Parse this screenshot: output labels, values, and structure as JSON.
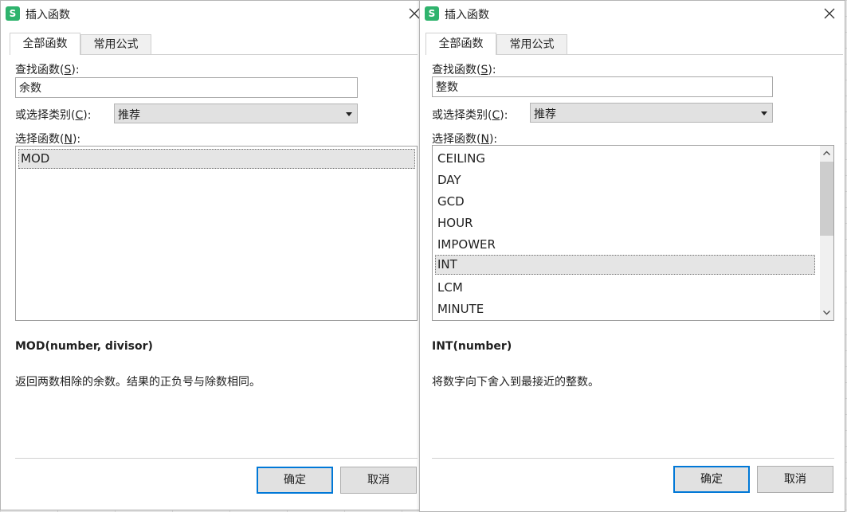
{
  "colors": {
    "accent": "#0078d7",
    "app_icon": "#2fb36d",
    "selected_row": "#e5e5e5"
  },
  "left": {
    "title": "插入函数",
    "app_icon_letter": "S",
    "tabs": [
      "全部函数",
      "常用公式"
    ],
    "search_label": "查找函数(",
    "search_key": "S",
    "search_label_end": "):",
    "search_value": "余数",
    "category_label": "或选择类别(",
    "category_key": "C",
    "category_label_end": "):",
    "category_value": "推荐",
    "func_label": "选择函数(",
    "func_key": "N",
    "func_label_end": "):",
    "functions": [
      "MOD"
    ],
    "signature": "MOD(number, divisor)",
    "description": "返回两数相除的余数。结果的正负号与除数相同。",
    "ok": "确定",
    "cancel": "取消"
  },
  "right": {
    "title": "插入函数",
    "app_icon_letter": "S",
    "tabs": [
      "全部函数",
      "常用公式"
    ],
    "search_label": "查找函数(",
    "search_key": "S",
    "search_label_end": "):",
    "search_value": "整数",
    "category_label": "或选择类别(",
    "category_key": "C",
    "category_label_end": "):",
    "category_value": "推荐",
    "func_label": "选择函数(",
    "func_key": "N",
    "func_label_end": "):",
    "functions": [
      "CEILING",
      "DAY",
      "GCD",
      "HOUR",
      "IMPOWER",
      "INT",
      "LCM",
      "MINUTE"
    ],
    "signature": "INT(number)",
    "description": "将数字向下舍入到最接近的整数。",
    "ok": "确定",
    "cancel": "取消"
  }
}
